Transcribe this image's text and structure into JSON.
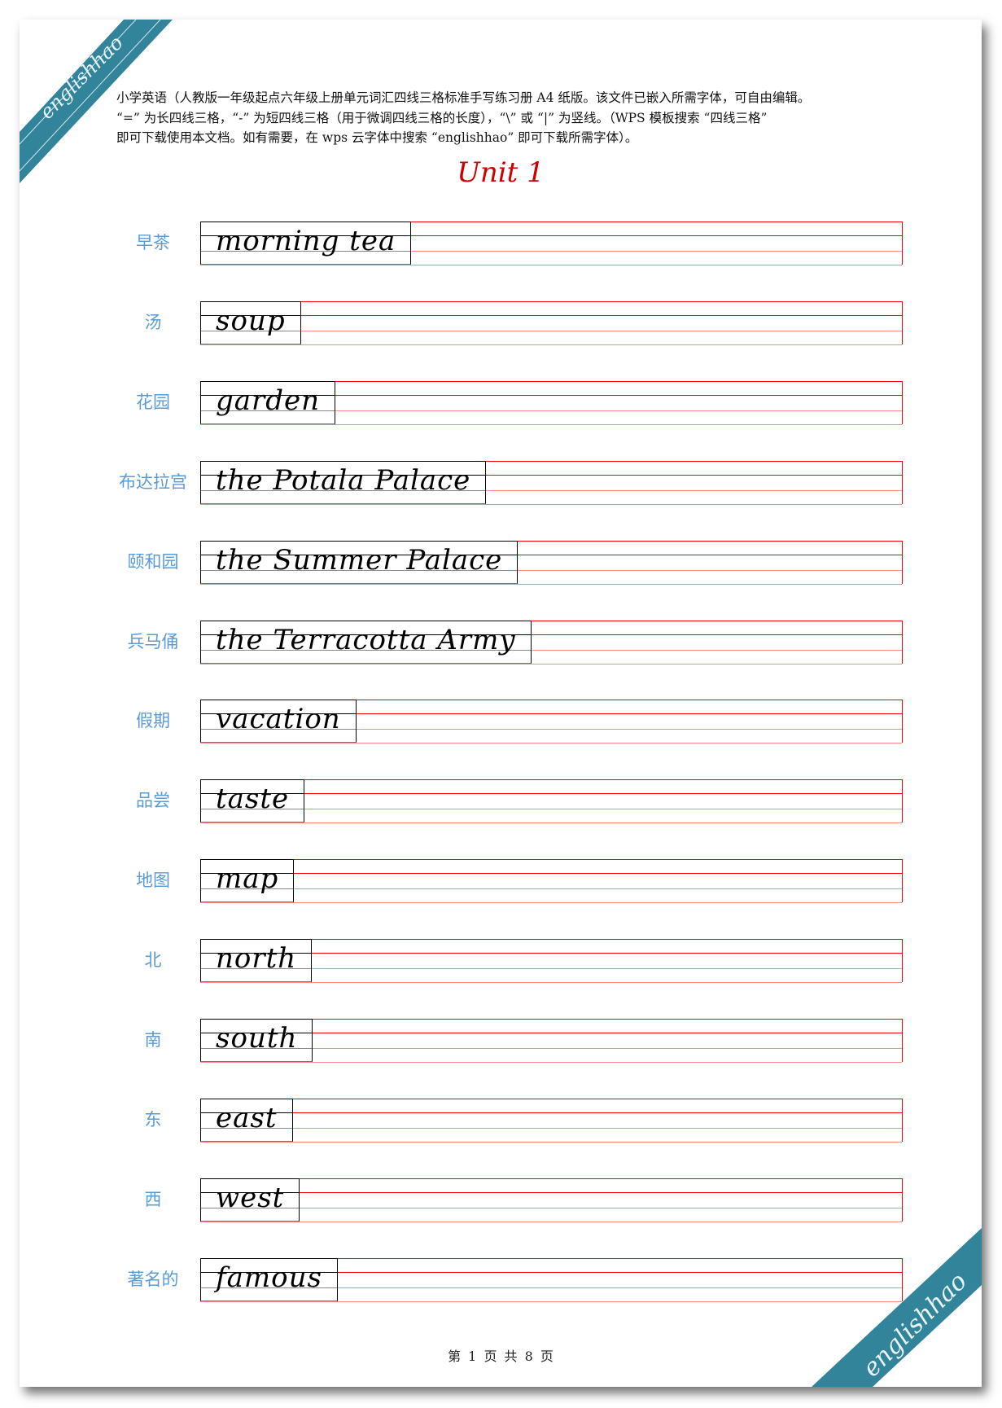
{
  "watermark": "englishhao",
  "intro": [
    "小学英语（人教版一年级起点六年级上册单元词汇四线三格标准手写练习册 A4 纸版。该文件已嵌入所需字体，可自由编辑。",
    "“=” 为长四线三格，“-” 为短四线三格（用于微调四线三格的长度），“\\” 或 “|” 为竖线。（WPS 模板搜索 “四线三格”",
    "即可下载使用本文档。如有需要，在 wps 云字体中搜索 “englishhao” 即可下载所需字体）。"
  ],
  "title": "Unit 1",
  "words": [
    {
      "cn": "早茶",
      "en": "morning tea"
    },
    {
      "cn": "汤",
      "en": "soup"
    },
    {
      "cn": "花园",
      "en": "garden"
    },
    {
      "cn": "布达拉宫",
      "en": "the Potala Palace"
    },
    {
      "cn": "颐和园",
      "en": "the Summer Palace"
    },
    {
      "cn": "兵马俑",
      "en": "the Terracotta Army"
    },
    {
      "cn": "假期",
      "en": "vacation"
    },
    {
      "cn": "品尝",
      "en": "taste"
    },
    {
      "cn": "地图",
      "en": "map"
    },
    {
      "cn": "北",
      "en": "north"
    },
    {
      "cn": "南",
      "en": "south"
    },
    {
      "cn": "东",
      "en": "east"
    },
    {
      "cn": "西",
      "en": "west"
    },
    {
      "cn": "著名的",
      "en": "famous"
    }
  ],
  "footer": "第 1 页 共 8 页",
  "colors": {
    "ribbon": "#32849b",
    "label": "#5b9bd5",
    "title": "#cc0000",
    "guide_line": "#ee0000"
  }
}
